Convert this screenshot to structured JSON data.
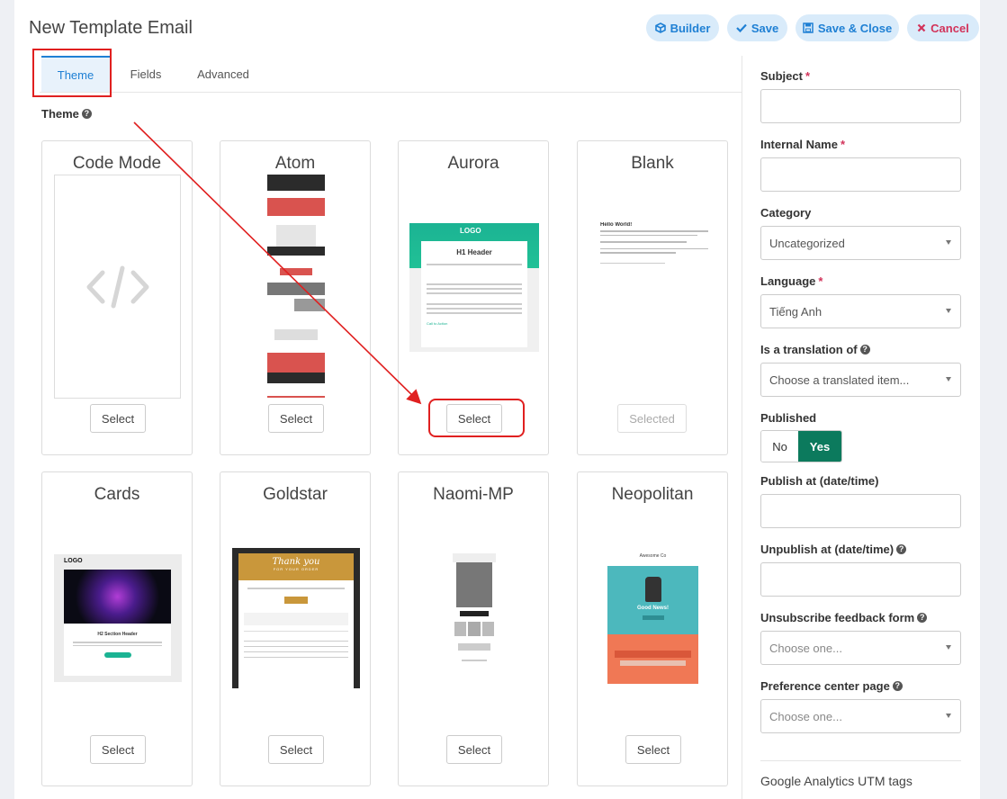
{
  "header": {
    "title": "New Template Email",
    "buttons": {
      "builder": "Builder",
      "save": "Save",
      "save_close": "Save & Close",
      "cancel": "Cancel"
    }
  },
  "tabs": [
    "Theme",
    "Fields",
    "Advanced"
  ],
  "theme_section": {
    "label": "Theme"
  },
  "themes": [
    {
      "name": "Code Mode",
      "button": "Select"
    },
    {
      "name": "Atom",
      "button": "Select"
    },
    {
      "name": "Aurora",
      "button": "Select"
    },
    {
      "name": "Blank",
      "button": "Selected"
    },
    {
      "name": "Cards",
      "button": "Select"
    },
    {
      "name": "Goldstar",
      "button": "Select"
    },
    {
      "name": "Naomi-MP",
      "button": "Select"
    },
    {
      "name": "Neopolitan",
      "button": "Select"
    }
  ],
  "thumbnails": {
    "aurora": {
      "logo": "LOGO",
      "header": "H1 Header",
      "link": "Call to Action"
    },
    "blank": {
      "greeting": "Hello World!"
    },
    "cards": {
      "logo": "LOGO",
      "header": "H2 Section Header"
    },
    "goldstar": {
      "thank": "Thank you",
      "sub": "FOR YOUR ORDER"
    },
    "neopolitan": {
      "brand": "Awesome Co",
      "news": "Good News!"
    }
  },
  "form": {
    "subject": {
      "label": "Subject",
      "value": ""
    },
    "internal_name": {
      "label": "Internal Name",
      "value": ""
    },
    "category": {
      "label": "Category",
      "value": "Uncategorized"
    },
    "language": {
      "label": "Language",
      "value": "Tiếng Anh"
    },
    "translation": {
      "label": "Is a translation of",
      "placeholder": "Choose a translated item..."
    },
    "published": {
      "label": "Published",
      "no": "No",
      "yes": "Yes",
      "value": "Yes"
    },
    "publish_at": {
      "label": "Publish at (date/time)",
      "value": ""
    },
    "unpublish_at": {
      "label": "Unpublish at (date/time)",
      "value": ""
    },
    "unsubscribe_form": {
      "label": "Unsubscribe feedback form",
      "placeholder": "Choose one..."
    },
    "preference_page": {
      "label": "Preference center page",
      "placeholder": "Choose one..."
    },
    "ga_label": "Google Analytics UTM tags"
  },
  "colors": {
    "accent": "#1f80d4",
    "cancel": "#d2335a",
    "published_yes": "#0c7a5d",
    "annotation": "#e02020"
  },
  "icons": [
    "cube-icon",
    "check-icon",
    "floppy-icon",
    "close-icon",
    "help-icon",
    "code-icon",
    "caret-down-icon"
  ]
}
